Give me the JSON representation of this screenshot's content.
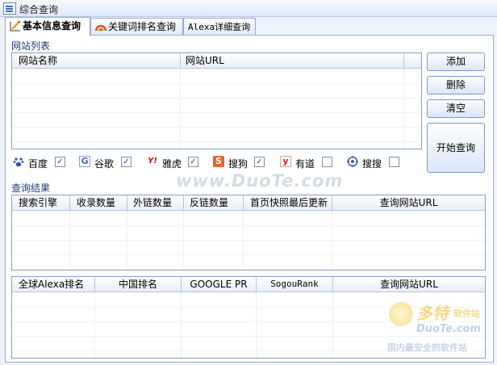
{
  "window": {
    "title": "综合查询"
  },
  "tabs": [
    {
      "label": "基本信息查询"
    },
    {
      "label": "关键词排名查询"
    },
    {
      "label": "Alexa详细查询"
    }
  ],
  "site_list": {
    "section_label": "网站列表",
    "columns": [
      "网站名称",
      "网站URL"
    ]
  },
  "buttons": {
    "add": "添加",
    "delete": "删除",
    "clear": "清空",
    "start": "开始查询"
  },
  "engines": [
    {
      "name": "百度",
      "checked": true
    },
    {
      "name": "谷歌",
      "checked": true
    },
    {
      "name": "雅虎",
      "checked": true
    },
    {
      "name": "搜狗",
      "checked": true
    },
    {
      "name": "有道",
      "checked": false
    },
    {
      "name": "搜搜",
      "checked": false
    }
  ],
  "results": {
    "section_label": "查询结果",
    "columns": [
      "搜索引擎",
      "收录数量",
      "外链数量",
      "反链数量",
      "首页快照最后更新",
      "查询网站URL"
    ]
  },
  "alexa_results": {
    "columns": [
      "全球Alexa排名",
      "中国排名",
      "GOOGLE PR",
      "SogouRank",
      "查询网站URL"
    ]
  },
  "watermark": {
    "main": "www.DuoTe.com",
    "brand": "多特",
    "brand_sub": "软件站",
    "brand_url": "DuoTe.com",
    "slogan": "国内最安全的软件站"
  },
  "colors": {
    "accent": "#1d3a7a",
    "border": "#9aaace"
  }
}
